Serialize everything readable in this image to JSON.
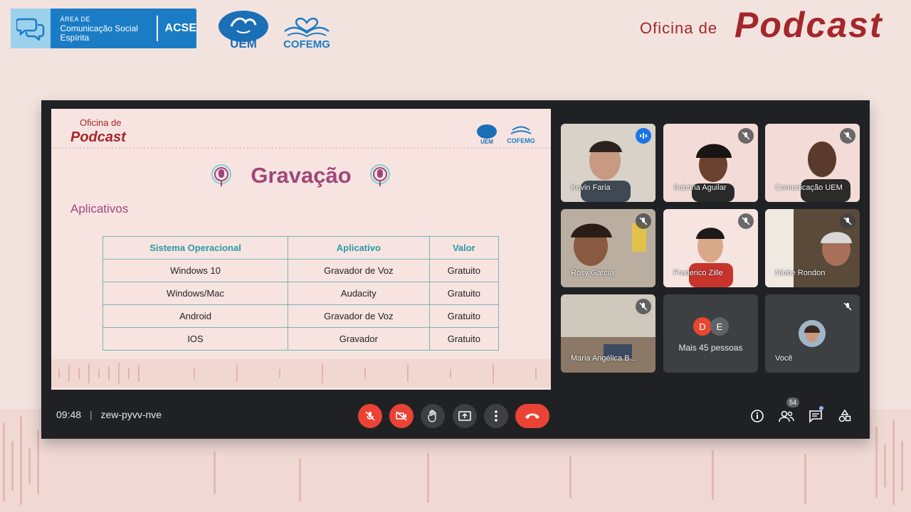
{
  "header": {
    "acse_line1": "ÁREA DE",
    "acse_line2": "Comunicação Social",
    "acse_line3": "Espírita",
    "acse_name": "ACSE",
    "uem_label": "UEM",
    "cofemg_label": "COFEMG",
    "brand_small": "Oficina de",
    "brand_big": "Podcast"
  },
  "slide": {
    "brand_small": "Oficina de",
    "brand_big": "Podcast",
    "logo_uem": "UEM",
    "logo_cofemg": "COFEMG",
    "title": "Gravação",
    "subtitle": "Aplicativos",
    "table": {
      "headers": [
        "Sistema Operacional",
        "Aplicativo",
        "Valor"
      ],
      "rows": [
        [
          "Windows 10",
          "Gravador de Voz",
          "Gratuito"
        ],
        [
          "Windows/Mac",
          "Audacity",
          "Gratuito"
        ],
        [
          "Android",
          "Gravador de Voz",
          "Gratuito"
        ],
        [
          "IOS",
          "Gravador",
          "Gratuito"
        ]
      ]
    }
  },
  "participants": [
    {
      "name": "Kevin Faria",
      "speaking": true
    },
    {
      "name": "Sabrina Aguilar",
      "muted": true
    },
    {
      "name": "Comunicação UEM",
      "muted": true
    },
    {
      "name": "Rosy Garcia",
      "muted": true
    },
    {
      "name": "Frederico Zille",
      "muted": true
    },
    {
      "name": "Niobe Rondon",
      "muted": true
    },
    {
      "name": "Maria Angélica B...",
      "muted": true
    }
  ],
  "more_people": {
    "label": "Mais 45 pessoas",
    "initials": [
      "D",
      "E"
    ],
    "colors": [
      "#e8472f",
      "#5f6368"
    ]
  },
  "self_tile": {
    "name": "Você",
    "muted": true
  },
  "control_bar": {
    "time": "09:48",
    "separator": "|",
    "meeting_code": "zew-pyvv-nve",
    "participants_count": "54"
  },
  "colors": {
    "brand_red": "#a5262b",
    "slide_pink": "#a04779",
    "table_teal": "#2a9aa5",
    "meet_bg": "#202124",
    "danger": "#ea4335"
  }
}
